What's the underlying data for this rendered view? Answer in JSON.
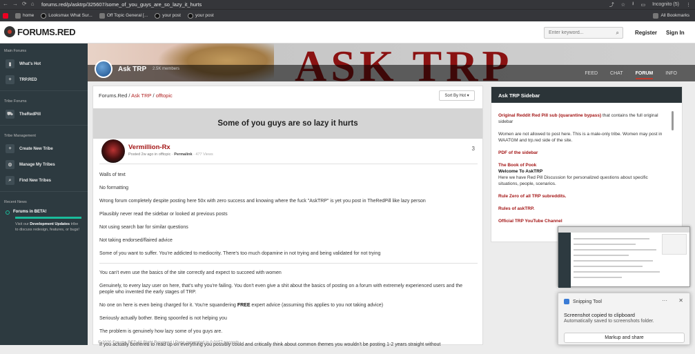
{
  "browser": {
    "url": "forums.red/p/asktrp/325607/some_of_you_guys_are_so_lazy_it_hurts",
    "profile": "Incognito (5)",
    "bookmarks": [
      {
        "label": "home",
        "icon": "home-icon"
      },
      {
        "label": "Looksmax What Sur...",
        "icon": "looksmax-icon"
      },
      {
        "label": "Off Topic General [...",
        "icon": "forum-icon"
      },
      {
        "label": "your post",
        "icon": "circle-icon"
      },
      {
        "label": "your post",
        "icon": "circle-icon"
      }
    ],
    "all_bookmarks": "All Bookmarks"
  },
  "header": {
    "logo": "FORUMS.RED",
    "search_placeholder": "Enter keyword...",
    "register": "Register",
    "signin": "Sign In"
  },
  "sidebar": {
    "main_heading": "Main Forums",
    "main_items": [
      {
        "label": "What's Hot",
        "icon": "trash-icon"
      },
      {
        "label": "TRP.RED",
        "icon": "plus-icon"
      }
    ],
    "tribe_heading": "Tribe Forums",
    "tribe_items": [
      {
        "label": "TheRedPill",
        "icon": "car-icon"
      }
    ],
    "mgmt_heading": "Tribe Management",
    "mgmt_items": [
      {
        "label": "Create New Tribe",
        "icon": "plus-icon"
      },
      {
        "label": "Manage My Tribes",
        "icon": "gear-icon"
      },
      {
        "label": "Find New Tribes",
        "icon": "search-icon"
      }
    ],
    "news_heading": "Recent News",
    "news_title": "Forums in BETA!",
    "news_desc_pre": "Visit our ",
    "news_desc_bold": "Development Updates",
    "news_desc_post": " tribe to discuss redesign, features, or bugs!"
  },
  "banner": {
    "tribe": "Ask TRP",
    "members": "2.5K members",
    "big_text": "ASK TRP",
    "tabs": [
      "FEED",
      "CHAT",
      "FORUM",
      "INFO"
    ],
    "active_tab": "FORUM"
  },
  "post": {
    "crumb_root": "Forums.Red",
    "crumb_tribe": "Ask TRP",
    "crumb_topic": "offtopic",
    "sort_label": "Sort By Hot",
    "title": "Some of you guys are so lazy it hurts",
    "author": "Vermillion-Rx",
    "posted": "Posted 2w ago in offtopic · ",
    "permalink": "Permalink",
    "views": " · 477 Views",
    "reply_count": "3",
    "paragraphs": [
      "Walls of text",
      "No formatting",
      "Wrong forum completely despite posting here 50x with zero success and knowing where the fuck \"AskTRP\" is yet you post in TheRedPill like lazy person",
      "Plausibly never read the sidebar or looked at previous posts",
      "Not using search bar for similar questions",
      "Not taking endorsed/flaired advice",
      "Some of you want to suffer. You're addicted to mediocrity. There's too much dopamine in not trying and being validated for not trying"
    ],
    "paragraphs2": [
      "You can't even use the basics of the site correctly and expect to succeed with women",
      "Genuinely, to every lazy user on here, that's why you're failing. You don't even give a shit about the basics of posting on a forum with extremely experienced users and the people who invented the early stages of TRP."
    ],
    "free_pre": "No one on here is even being charged for it. You're squandering ",
    "free_bold": "FREE",
    "free_post": " expert advice (assuming this applies to you not taking advice)",
    "paragraphs3": [
      "Seriously actually bother. Being spoonfed is not helping you",
      "The problem is genuinely how lazy some of you guys are.",
      "If you actually bothered to read up on everything you possibly could and critically think about common themes you wouldn't be posting 1-2 years straight without"
    ],
    "footer": "© 2020 Forums.RED All Right Reserved | Page generated in 0.0157 seconds"
  },
  "right_sidebar": {
    "title": "Ask TRP Sidebar",
    "link1": "Original Reddit Red Pill sub (quarantine bypass)",
    "link1_post": " that contains the full original sidebar",
    "rule_text": "Women are not allowed to post here. This is a male-only tribe. Women may post in WAATGM and trp.red side of the site.",
    "pdf": "PDF of the sidebar",
    "pook": "The Book of Pook",
    "welcome": "Welcome To AskTRP",
    "welcome_text": "Here we have Red Pill Discussion for personalized questions about specific situations, people, scenarios.",
    "rule_zero": "Rule Zero of all TRP subreddits.",
    "rules": "Rules of askTRP.",
    "youtube": "Official TRP YouTube Channel"
  },
  "snipping": {
    "app": "Snipping Tool",
    "title": "Screenshot copied to clipboard",
    "subtitle": "Automatically saved to screenshots folder.",
    "button": "Markup and share"
  },
  "colors": {
    "accent": "#a31515",
    "sidebar_bg": "#2d3a40",
    "teal": "#1abc9c"
  }
}
